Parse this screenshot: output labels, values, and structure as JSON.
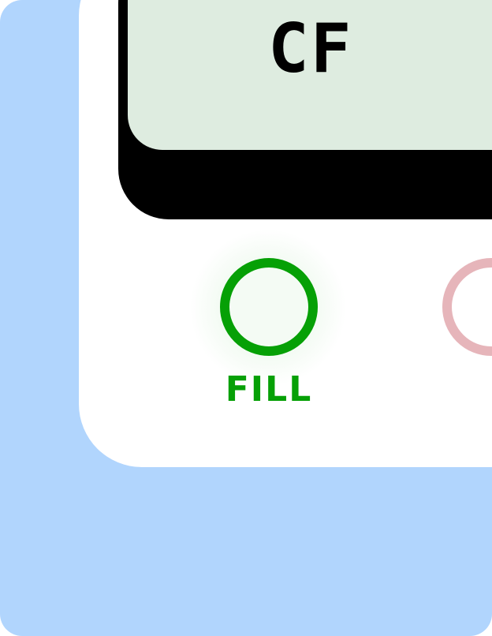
{
  "colors": {
    "outer_background": "#b1d5fd",
    "device_body": "#ffffff",
    "screen_bezel": "#000000",
    "screen_background": "#deece0",
    "fill_accent": "#06a006",
    "fill_glow": "#f4fbf4",
    "second_ring": "#e6b5ba"
  },
  "screen": {
    "text": "CF"
  },
  "buttons": {
    "fill": {
      "label": "FILL",
      "icon": "ring-icon"
    },
    "second": {
      "icon": "ring-icon"
    }
  }
}
